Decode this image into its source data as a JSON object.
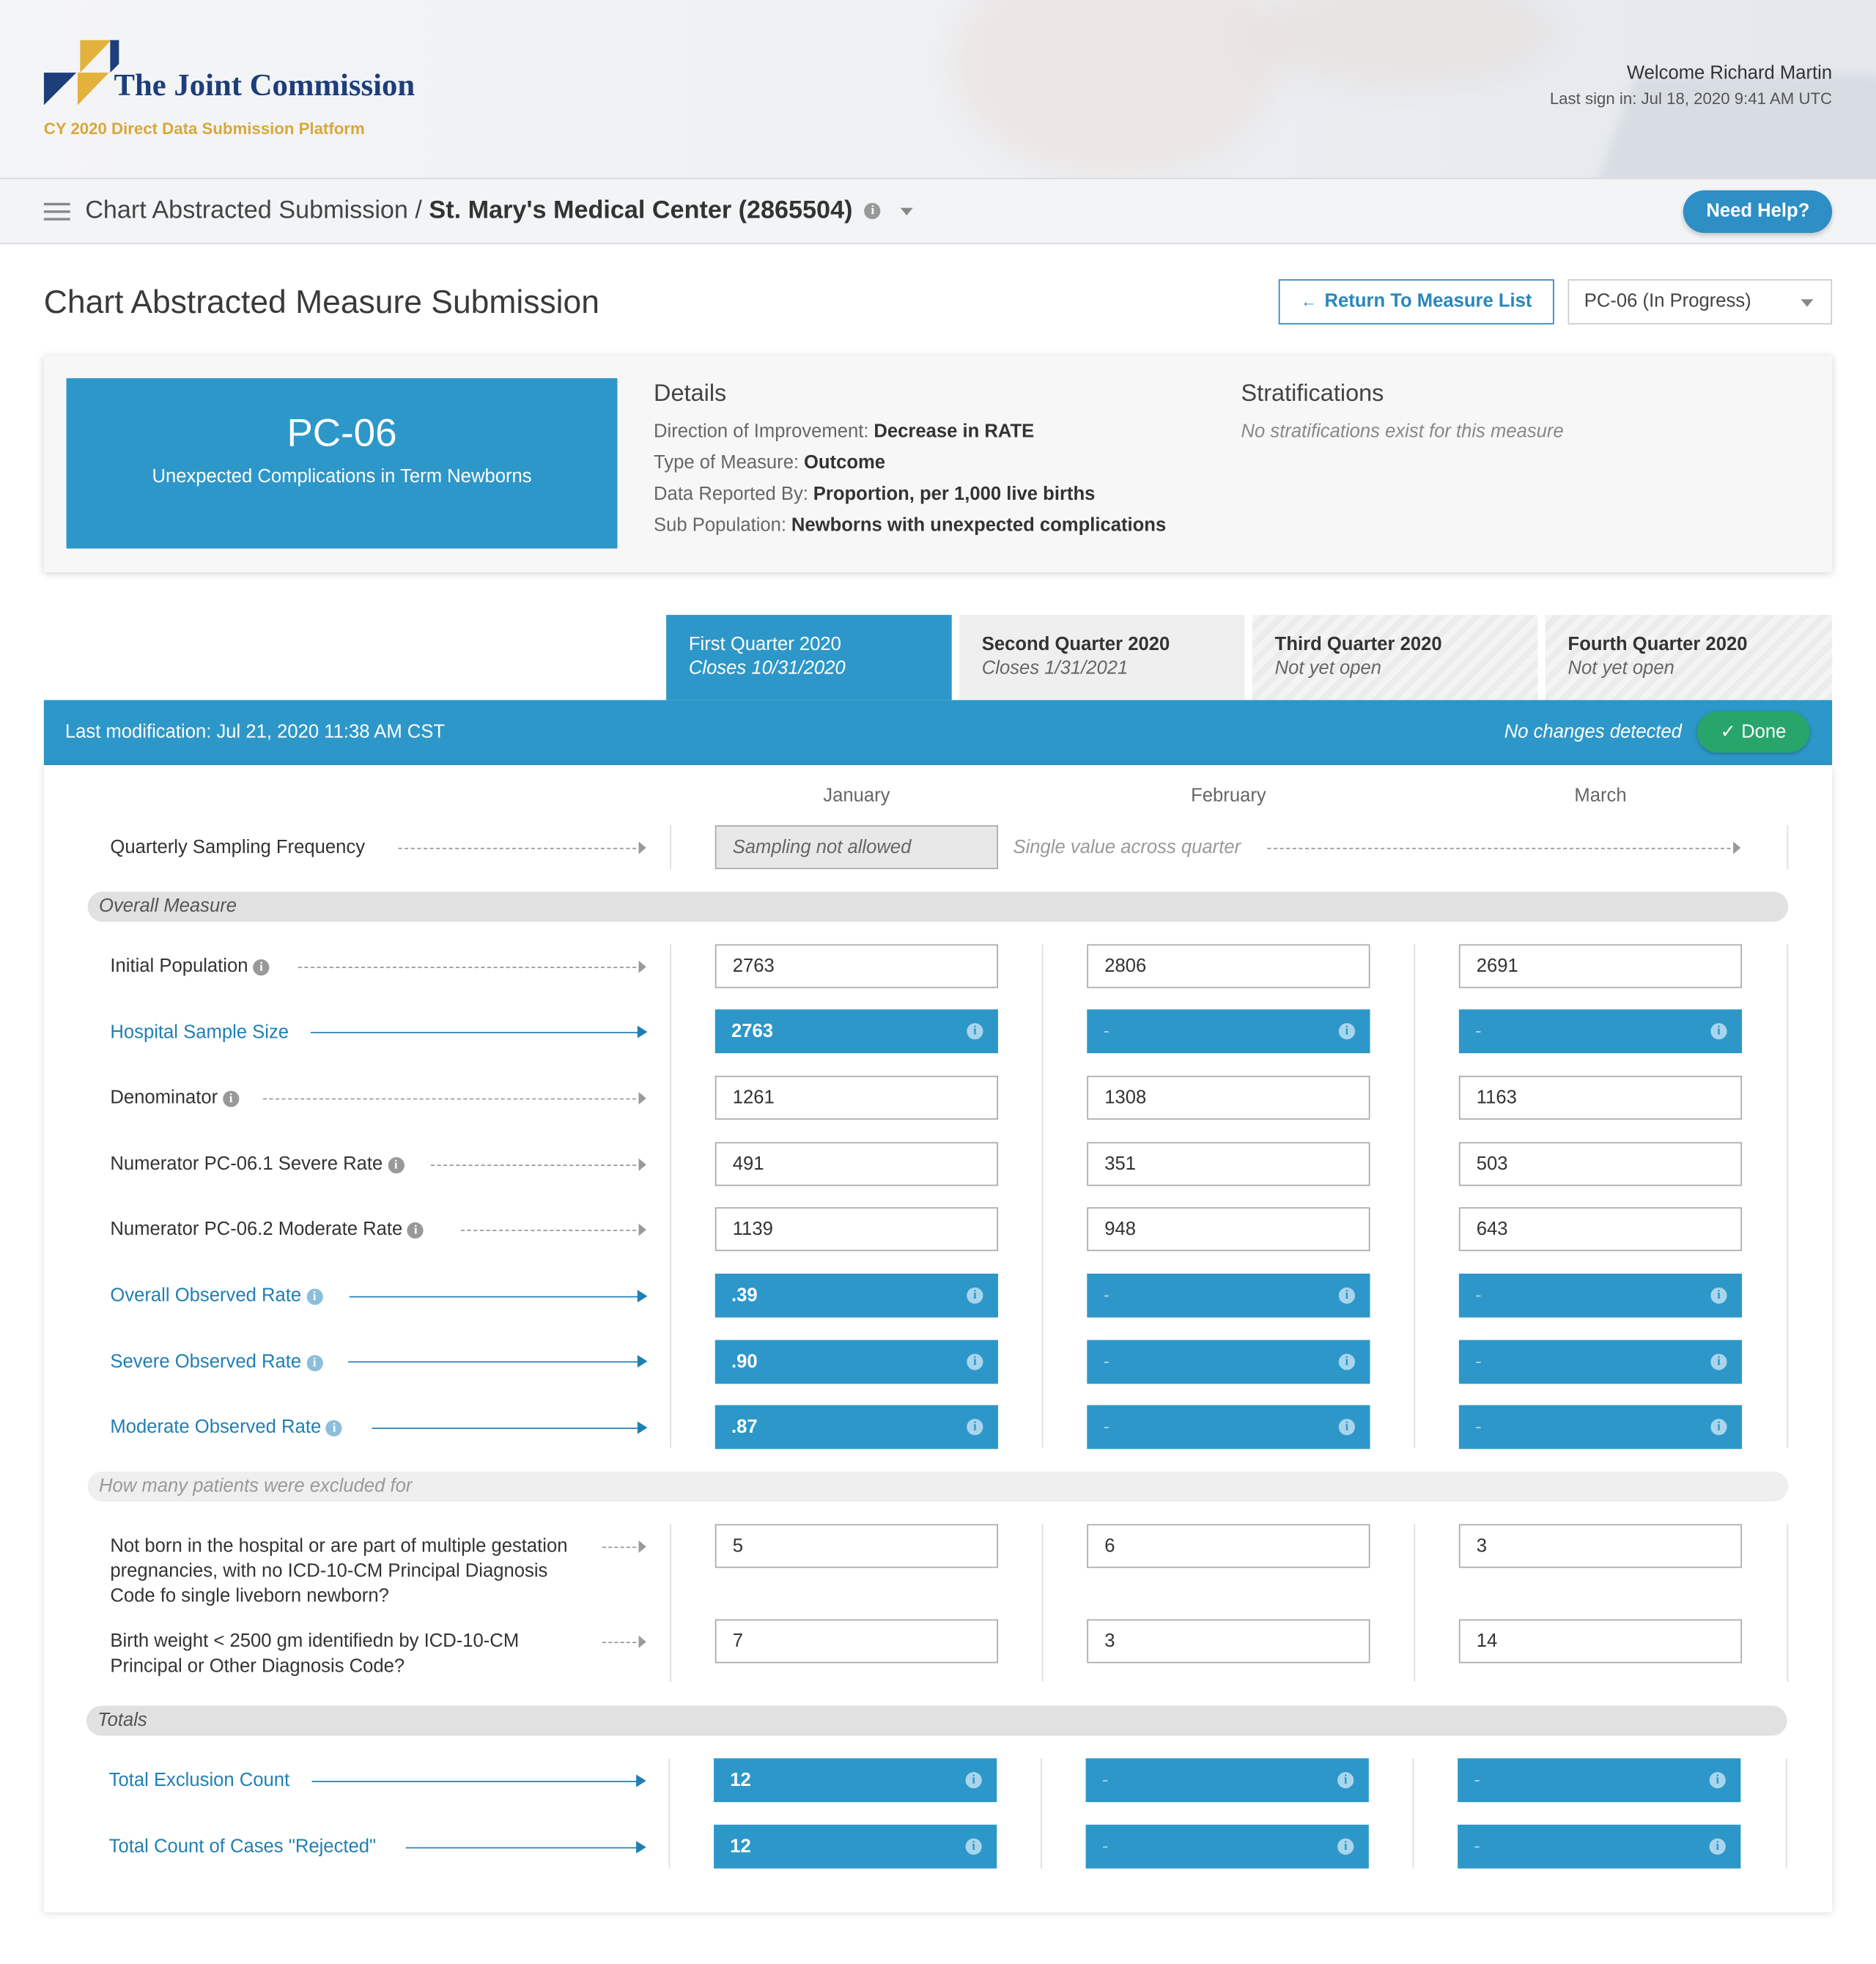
{
  "header": {
    "brand_name": "The Joint Commission",
    "platform": "CY 2020 Direct Data Submission Platform",
    "welcome": "Welcome Richard Martin",
    "last_sign_in": "Last sign in: Jul 18, 2020 9:41 AM UTC"
  },
  "nav": {
    "crumb_section": "Chart Abstracted Submission /",
    "crumb_org": "St. Mary's Medical Center (2865504)",
    "help_label": "Need Help?"
  },
  "page": {
    "title": "Chart Abstracted Measure Submission",
    "return_label": "Return To Measure List",
    "measure_select": "PC-06 (In Progress)"
  },
  "measure": {
    "code": "PC-06",
    "name": "Unexpected Complications in Term Newborns",
    "details_heading": "Details",
    "details": [
      {
        "label": "Direction of Improvement:",
        "value": "Decrease in RATE"
      },
      {
        "label": "Type of Measure:",
        "value": "Outcome"
      },
      {
        "label": "Data Reported By:",
        "value": "Proportion, per 1,000 live births"
      },
      {
        "label": "Sub Population:",
        "value": "Newborns with unexpected complications"
      }
    ],
    "strat_heading": "Stratifications",
    "strat_note": "No stratifications exist for this measure"
  },
  "tabs": [
    {
      "name": "First Quarter 2020",
      "sub": "Closes 10/31/2020"
    },
    {
      "name": "Second Quarter 2020",
      "sub": "Closes 1/31/2021"
    },
    {
      "name": "Third Quarter 2020",
      "sub": "Not yet open"
    },
    {
      "name": "Fourth Quarter 2020",
      "sub": "Not yet open"
    }
  ],
  "status": {
    "last_mod_label": "Last modification:",
    "last_mod_value": "Jul 21, 2020 11:38 AM CST",
    "no_changes": "No changes detected",
    "done_label": "✓ Done"
  },
  "months": [
    "January",
    "February",
    "March"
  ],
  "sampling": {
    "label": "Quarterly Sampling Frequency",
    "value": "Sampling not allowed",
    "note": "Single value across quarter"
  },
  "sections": {
    "overall": "Overall Measure",
    "exclusions": "How many patients were excluded for",
    "totals": "Totals"
  },
  "rows": [
    {
      "label": "Initial Population",
      "values": [
        "2763",
        "2806",
        "2691"
      ]
    },
    {
      "label": "Hospital Sample Size",
      "values": [
        "2763",
        "-",
        "-"
      ]
    },
    {
      "label": "Denominator",
      "values": [
        "1261",
        "1308",
        "1163"
      ]
    },
    {
      "label": "Numerator PC-06.1 Severe Rate",
      "values": [
        "491",
        "351",
        "503"
      ]
    },
    {
      "label": "Numerator PC-06.2 Moderate Rate",
      "values": [
        "1139",
        "948",
        "643"
      ]
    },
    {
      "label": "Overall Observed Rate",
      "values": [
        ".39",
        "-",
        "-"
      ]
    },
    {
      "label": "Severe Observed Rate",
      "values": [
        ".90",
        "-",
        "-"
      ]
    },
    {
      "label": "Moderate Observed Rate",
      "values": [
        ".87",
        "-",
        "-"
      ]
    }
  ],
  "exclusions": [
    {
      "label": "Not born in the hospital or are part of multiple gestation pregnancies, with no ICD-10-CM Principal Diagnosis Code fo single liveborn newborn?",
      "values": [
        "5",
        "6",
        "3"
      ]
    },
    {
      "label": "Birth weight < 2500 gm identifiedn by ICD-10-CM Principal or Other Diagnosis Code?",
      "values": [
        "7",
        "3",
        "14"
      ]
    }
  ],
  "totals": [
    {
      "label": "Total Exclusion Count",
      "values": [
        "12",
        "-",
        "-"
      ]
    },
    {
      "label": "Total Count of Cases \"Rejected\"",
      "values": [
        "12",
        "-",
        "-"
      ]
    }
  ],
  "colors": {
    "primary": "#2d97c9",
    "link": "#1f7fb4",
    "done": "#27a56b",
    "brand_navy": "#1d3e7a",
    "brand_gold": "#d8a83a"
  },
  "icons": [
    "menu-icon",
    "info-icon",
    "chevron-down-icon",
    "arrow-left-icon",
    "check-icon"
  ]
}
